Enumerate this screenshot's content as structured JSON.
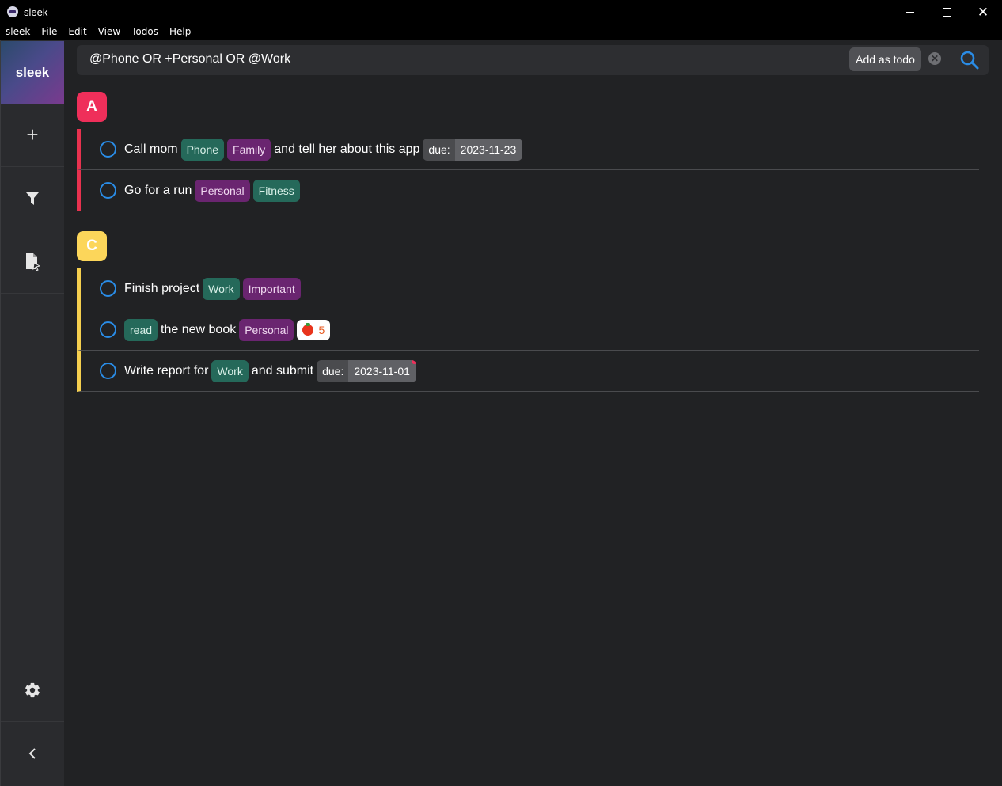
{
  "window": {
    "title": "sleek"
  },
  "menu": [
    "sleek",
    "File",
    "Edit",
    "View",
    "Todos",
    "Help"
  ],
  "sidebar": {
    "brand": "sleek",
    "items": [
      {
        "name": "add-todo",
        "icon": "plus-icon"
      },
      {
        "name": "filter",
        "icon": "filter-icon"
      },
      {
        "name": "files",
        "icon": "file-icon"
      },
      {
        "name": "settings",
        "icon": "gear-icon"
      },
      {
        "name": "collapse",
        "icon": "chevron-left-icon"
      }
    ]
  },
  "search": {
    "value": "@Phone OR +Personal OR @Work",
    "add_label": "Add as todo"
  },
  "groups": [
    {
      "priority": "A",
      "color": "#ef2f5a",
      "todos": [
        {
          "text1": "Call mom",
          "tag1": "Phone",
          "tag2": "Family",
          "text2": "and tell her about this app",
          "due_label": "due:",
          "due": "2023-11-23"
        },
        {
          "text1": "Go for a run",
          "tag1": "Personal",
          "tag2": "Fitness"
        }
      ]
    },
    {
      "priority": "C",
      "color": "#fcd65a",
      "todos": [
        {
          "text1": "Finish project",
          "tag1": "Work",
          "tag2": "Important"
        },
        {
          "tag0": "read",
          "text1": "the new book",
          "tag1": "Personal",
          "pomodoro": "5"
        },
        {
          "text1": "Write report for",
          "tag1": "Work",
          "text2": "and submit",
          "due_label": "due:",
          "due": "2023-11-01"
        }
      ]
    }
  ],
  "colors": {
    "accent": "#2a8ce6",
    "context_tag": "#25695a",
    "project_tag": "#6a2570",
    "overdue": "#ef2f5a"
  }
}
